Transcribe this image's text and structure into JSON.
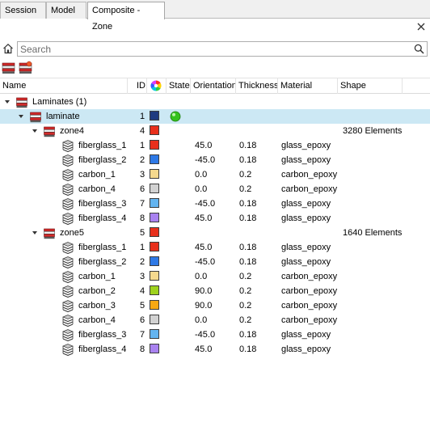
{
  "tabs": [
    {
      "label": "Session"
    },
    {
      "label": "Model"
    },
    {
      "label": "Composite - Zone"
    }
  ],
  "search": {
    "placeholder": "Search",
    "value": ""
  },
  "columns": {
    "name": "Name",
    "id": "ID",
    "state": "State",
    "orientation": "Orientation",
    "thickness": "Thickness",
    "material": "Material",
    "shape": "Shape"
  },
  "tree": [
    {
      "name": "Laminates (1)",
      "level": 0,
      "type": "folder",
      "expanded": true
    },
    {
      "name": "laminate",
      "level": 1,
      "type": "laminate",
      "expanded": true,
      "id": "1",
      "color": "#1f3a80",
      "state": "active",
      "selected": true
    },
    {
      "name": "zone4",
      "level": 2,
      "type": "zone",
      "expanded": true,
      "id": "4",
      "color": "#e8301c",
      "shape": "3280 Elements"
    },
    {
      "name": "fiberglass_1",
      "level": 3,
      "type": "ply",
      "id": "1",
      "color": "#e8301c",
      "orientation": "45.0",
      "thickness": "0.18",
      "material": "glass_epoxy"
    },
    {
      "name": "fiberglass_2",
      "level": 3,
      "type": "ply",
      "id": "2",
      "color": "#2e79e6",
      "orientation": "-45.0",
      "thickness": "0.18",
      "material": "glass_epoxy"
    },
    {
      "name": "carbon_1",
      "level": 3,
      "type": "ply",
      "id": "3",
      "color": "#f5d98e",
      "orientation": "0.0",
      "thickness": "0.2",
      "material": "carbon_epoxy"
    },
    {
      "name": "carbon_4",
      "level": 3,
      "type": "ply",
      "id": "6",
      "color": "#d2d2d2",
      "orientation": "0.0",
      "thickness": "0.2",
      "material": "carbon_epoxy"
    },
    {
      "name": "fiberglass_3",
      "level": 3,
      "type": "ply",
      "id": "7",
      "color": "#63b4f0",
      "orientation": "-45.0",
      "thickness": "0.18",
      "material": "glass_epoxy"
    },
    {
      "name": "fiberglass_4",
      "level": 3,
      "type": "ply",
      "id": "8",
      "color": "#a982f0",
      "orientation": "45.0",
      "thickness": "0.18",
      "material": "glass_epoxy"
    },
    {
      "name": "zone5",
      "level": 2,
      "type": "zone",
      "expanded": true,
      "id": "5",
      "color": "#e8301c",
      "shape": "1640 Elements"
    },
    {
      "name": "fiberglass_1",
      "level": 3,
      "type": "ply",
      "id": "1",
      "color": "#e8301c",
      "orientation": "45.0",
      "thickness": "0.18",
      "material": "glass_epoxy"
    },
    {
      "name": "fiberglass_2",
      "level": 3,
      "type": "ply",
      "id": "2",
      "color": "#2e79e6",
      "orientation": "-45.0",
      "thickness": "0.18",
      "material": "glass_epoxy"
    },
    {
      "name": "carbon_1",
      "level": 3,
      "type": "ply",
      "id": "3",
      "color": "#f5d98e",
      "orientation": "0.0",
      "thickness": "0.2",
      "material": "carbon_epoxy"
    },
    {
      "name": "carbon_2",
      "level": 3,
      "type": "ply",
      "id": "4",
      "color": "#9ed21e",
      "orientation": "90.0",
      "thickness": "0.2",
      "material": "carbon_epoxy"
    },
    {
      "name": "carbon_3",
      "level": 3,
      "type": "ply",
      "id": "5",
      "color": "#f7a812",
      "orientation": "90.0",
      "thickness": "0.2",
      "material": "carbon_epoxy"
    },
    {
      "name": "carbon_4",
      "level": 3,
      "type": "ply",
      "id": "6",
      "color": "#d2d2d2",
      "orientation": "0.0",
      "thickness": "0.2",
      "material": "carbon_epoxy"
    },
    {
      "name": "fiberglass_3",
      "level": 3,
      "type": "ply",
      "id": "7",
      "color": "#63b4f0",
      "orientation": "-45.0",
      "thickness": "0.18",
      "material": "glass_epoxy"
    },
    {
      "name": "fiberglass_4",
      "level": 3,
      "type": "ply",
      "id": "8",
      "color": "#a982f0",
      "orientation": "45.0",
      "thickness": "0.18",
      "material": "glass_epoxy"
    }
  ]
}
